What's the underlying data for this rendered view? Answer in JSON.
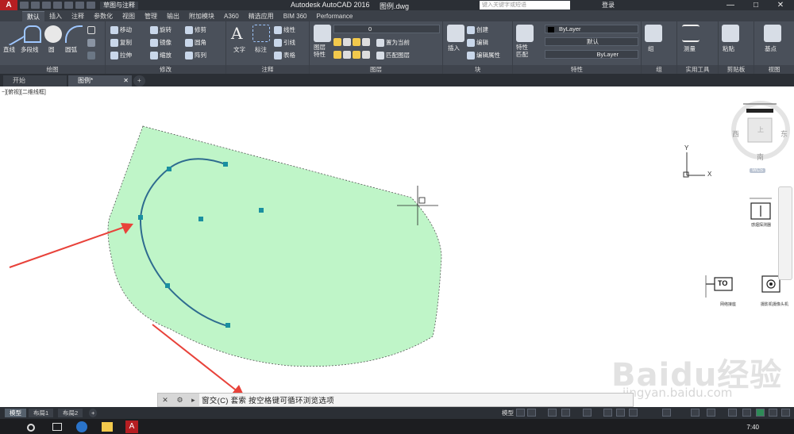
{
  "titlebar": {
    "logo": "A",
    "workspace": "草图与注释",
    "app_title": "Autodesk AutoCAD 2016",
    "file_name": "图例.dwg",
    "search_placeholder": "键入关键字或短语",
    "login": "登录",
    "min": "—",
    "max": "□",
    "close": "✕"
  },
  "ribbon_tabs": [
    "默认",
    "插入",
    "注释",
    "参数化",
    "视图",
    "管理",
    "输出",
    "附加模块",
    "A360",
    "精选应用",
    "BIM 360",
    "Performance"
  ],
  "ribbon": {
    "draw": {
      "label": "绘图",
      "line": "直线",
      "polyline": "多段线",
      "circle": "圆",
      "arc": "圆弧"
    },
    "modify": {
      "label": "修改",
      "move": "移动",
      "rotate": "旋转",
      "trim": "修剪",
      "copy": "复制",
      "mirror": "镜像",
      "fillet": "圆角",
      "stretch": "拉伸",
      "scale": "缩放",
      "array": "阵列"
    },
    "annotation": {
      "label": "注释",
      "text": "文字",
      "dimension": "标注",
      "linear": "线性",
      "leader": "引线",
      "table": "表格"
    },
    "layers": {
      "label": "图层",
      "layer_props": "图层\n特性",
      "layer_value": "0",
      "set_current": "置为当前",
      "match_layer": "匹配图层"
    },
    "block": {
      "label": "块",
      "insert": "插入",
      "create": "创建",
      "edit": "编辑",
      "edit_attr": "编辑属性"
    },
    "properties": {
      "label": "特性",
      "match": "特性\n匹配",
      "color": "ByLayer",
      "linetype": "默认",
      "lineweight": "ByLayer"
    },
    "groups": {
      "label": "组",
      "group": "组"
    },
    "utilities": {
      "label": "实用工具",
      "measure": "测量"
    },
    "clipboard": {
      "label": "剪贴板",
      "paste": "粘贴"
    },
    "view": {
      "label": "视图",
      "base": "基点"
    }
  },
  "doc_tabs": {
    "start": "开始",
    "drawing": "图例*",
    "close": "✕",
    "new": "+"
  },
  "viewport_label": "−][俯视][二维线框]",
  "viewcube": {
    "north": "北",
    "south": "南",
    "east": "东",
    "west": "西",
    "top": "上",
    "wcs": "WCS"
  },
  "ucs": {
    "x": "X",
    "y": "Y"
  },
  "legend_blocks": [
    "感烟探测器",
    "网络接座",
    "摄影机摄像头机"
  ],
  "legend_block_to": "TO",
  "command": {
    "text": "窗交(C)  套索   按空格键可循环浏览选项"
  },
  "layout_tabs": [
    "模型",
    "布局1",
    "布局2"
  ],
  "layout_new": "+",
  "status": {
    "model": "模型"
  },
  "clock": "7:40",
  "watermark": "Baidu经验",
  "watermark_sub": "jingyan.baidu.com",
  "colors": {
    "selection_fill": "#bff5c8",
    "arc": "#2e6b8f",
    "grip": "#1a8fa0",
    "arrow": "#e8423a"
  }
}
